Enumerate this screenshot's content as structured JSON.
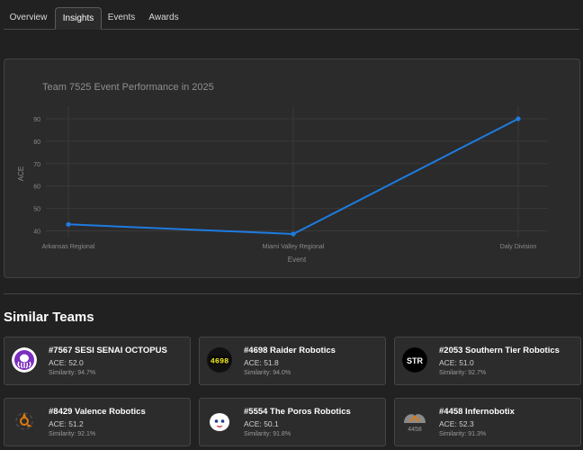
{
  "tabs": [
    {
      "label": "Overview",
      "active": false
    },
    {
      "label": "Insights",
      "active": true
    },
    {
      "label": "Events",
      "active": false
    },
    {
      "label": "Awards",
      "active": false
    }
  ],
  "chart": {
    "colors": {
      "line": "#1e7be0",
      "grid": "#3a3a3a",
      "text": "#8a8a8a",
      "title": "#8f8f8f"
    }
  },
  "chart_data": {
    "type": "line",
    "title": "Team 7525 Event Performance in 2025",
    "xlabel": "Event",
    "ylabel": "ACE",
    "categories": [
      "Arkansas Regional",
      "Miami Valley Regional",
      "Daly Division"
    ],
    "series": [
      {
        "values": [
          42.9,
          38.6,
          90.0
        ]
      }
    ],
    "ylim": [
      37,
      94
    ],
    "yticks": [
      40,
      50,
      60,
      70,
      80,
      90
    ],
    "grid": true
  },
  "similar": {
    "title": "Similar Teams",
    "ace_prefix": "ACE: ",
    "sim_prefix": "Similarity: ",
    "teams": [
      {
        "name": "#7567 SESI SENAI OCTOPUS",
        "ace": "52.0",
        "similarity": "94.7%",
        "logo_icon": "octopus-logo-icon"
      },
      {
        "name": "#4698 Raider Robotics",
        "ace": "51.8",
        "similarity": "94.0%",
        "logo_icon": "4698-logo-icon",
        "logo_text": "4698"
      },
      {
        "name": "#2053 Southern Tier Robotics",
        "ace": "51.0",
        "similarity": "92.7%",
        "logo_icon": "str-logo-icon",
        "logo_text": "STR"
      },
      {
        "name": "#8429 Valence Robotics",
        "ace": "51.2",
        "similarity": "92.1%",
        "logo_icon": "valence-logo-icon"
      },
      {
        "name": "#5554 The Poros Robotics",
        "ace": "50.1",
        "similarity": "91.8%",
        "logo_icon": "poros-logo-icon"
      },
      {
        "name": "#4458 Infernobotix",
        "ace": "52.3",
        "similarity": "91.3%",
        "logo_icon": "infernobotix-logo-icon",
        "logo_text": "4458"
      }
    ]
  }
}
